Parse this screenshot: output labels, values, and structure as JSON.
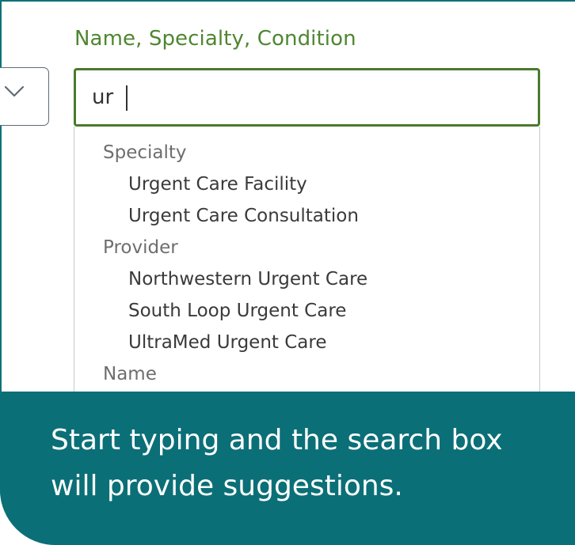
{
  "search": {
    "label": "Name, Specialty, Condition",
    "value": "ur"
  },
  "scope_select": {
    "icon": "chevron-down-icon"
  },
  "suggestions": {
    "groups": [
      {
        "label": "Specialty",
        "items": [
          "Urgent Care Facility",
          "Urgent Care Consultation"
        ]
      },
      {
        "label": "Provider",
        "items": [
          "Northwestern Urgent Care",
          "South Loop Urgent Care",
          "UltraMed Urgent Care"
        ]
      },
      {
        "label": "Name",
        "items": []
      }
    ]
  },
  "tooltip": {
    "text": "Start typing and the search box will provide suggestions."
  },
  "colors": {
    "label_green": "#4f8631",
    "input_border": "#4a7a2d",
    "tooltip_teal": "#0b6f77",
    "frame_border": "#0e7179"
  }
}
